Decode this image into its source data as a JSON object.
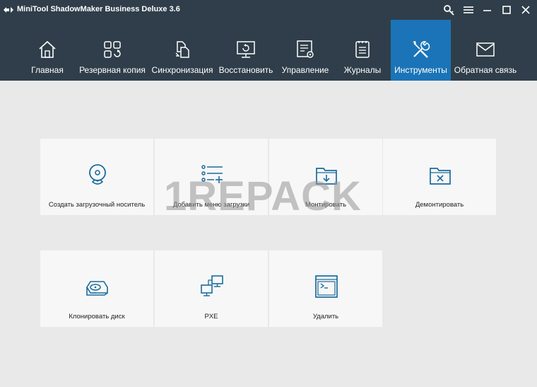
{
  "window": {
    "title": "MiniTool ShadowMaker Business Deluxe 3.6",
    "app_icon": "app-logo-icon",
    "controls": [
      "key-icon",
      "menu-icon",
      "minimize-icon",
      "maximize-icon",
      "close-icon"
    ]
  },
  "nav": {
    "active": "tools",
    "items": [
      {
        "id": "home",
        "label": "Главная",
        "icon": "home-icon"
      },
      {
        "id": "backup",
        "label": "Резервная копия",
        "icon": "backup-icon"
      },
      {
        "id": "sync",
        "label": "Синхронизация",
        "icon": "sync-icon"
      },
      {
        "id": "restore",
        "label": "Восстановить",
        "icon": "restore-icon"
      },
      {
        "id": "manage",
        "label": "Управление",
        "icon": "manage-icon"
      },
      {
        "id": "logs",
        "label": "Журналы",
        "icon": "logs-icon"
      },
      {
        "id": "tools",
        "label": "Инструменты",
        "icon": "tools-icon"
      },
      {
        "id": "feedback",
        "label": "Обратная связь",
        "icon": "mail-icon"
      }
    ]
  },
  "tools": {
    "row1": [
      {
        "label": "Создать загрузочный носитель",
        "icon": "boot-media-icon"
      },
      {
        "label": "Добавить меню загрузки",
        "icon": "boot-menu-icon"
      },
      {
        "label": "Монтировать",
        "icon": "mount-icon"
      },
      {
        "label": "Демонтировать",
        "icon": "unmount-icon"
      }
    ],
    "row2": [
      {
        "label": "Клонировать диск",
        "icon": "clone-disk-icon"
      },
      {
        "label": "PXE",
        "icon": "pxe-icon"
      },
      {
        "label": "Удалить",
        "icon": "remote-icon"
      }
    ]
  },
  "watermark": "1REPACK",
  "colors": {
    "header": "#2f3e4a",
    "active_tab": "#1b74b7",
    "tile_bg": "#f7f7f7",
    "icon_blue": "#1a6b9c",
    "background": "#e9e9e9"
  }
}
